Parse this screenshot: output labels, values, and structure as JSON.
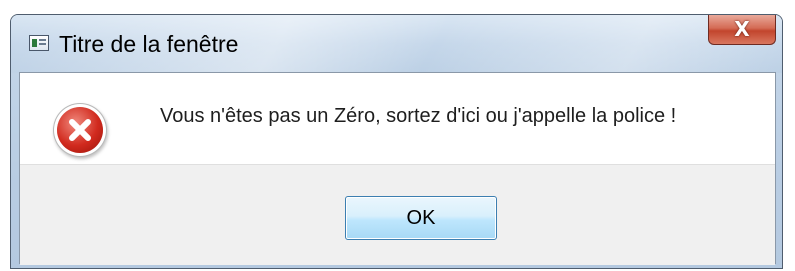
{
  "window": {
    "title": "Titre de la fenêtre",
    "close_label": "X",
    "app_icon": "application-window-icon"
  },
  "dialog": {
    "icon": "error-icon",
    "message": "Vous n'êtes pas un Zéro, sortez d'ici ou j'appelle la police !",
    "ok_label": "OK"
  },
  "colors": {
    "error_red": "#d12a1e",
    "close_red": "#c2452d",
    "ok_border": "#3c7fb1",
    "button_area": "#f0f0f0"
  }
}
